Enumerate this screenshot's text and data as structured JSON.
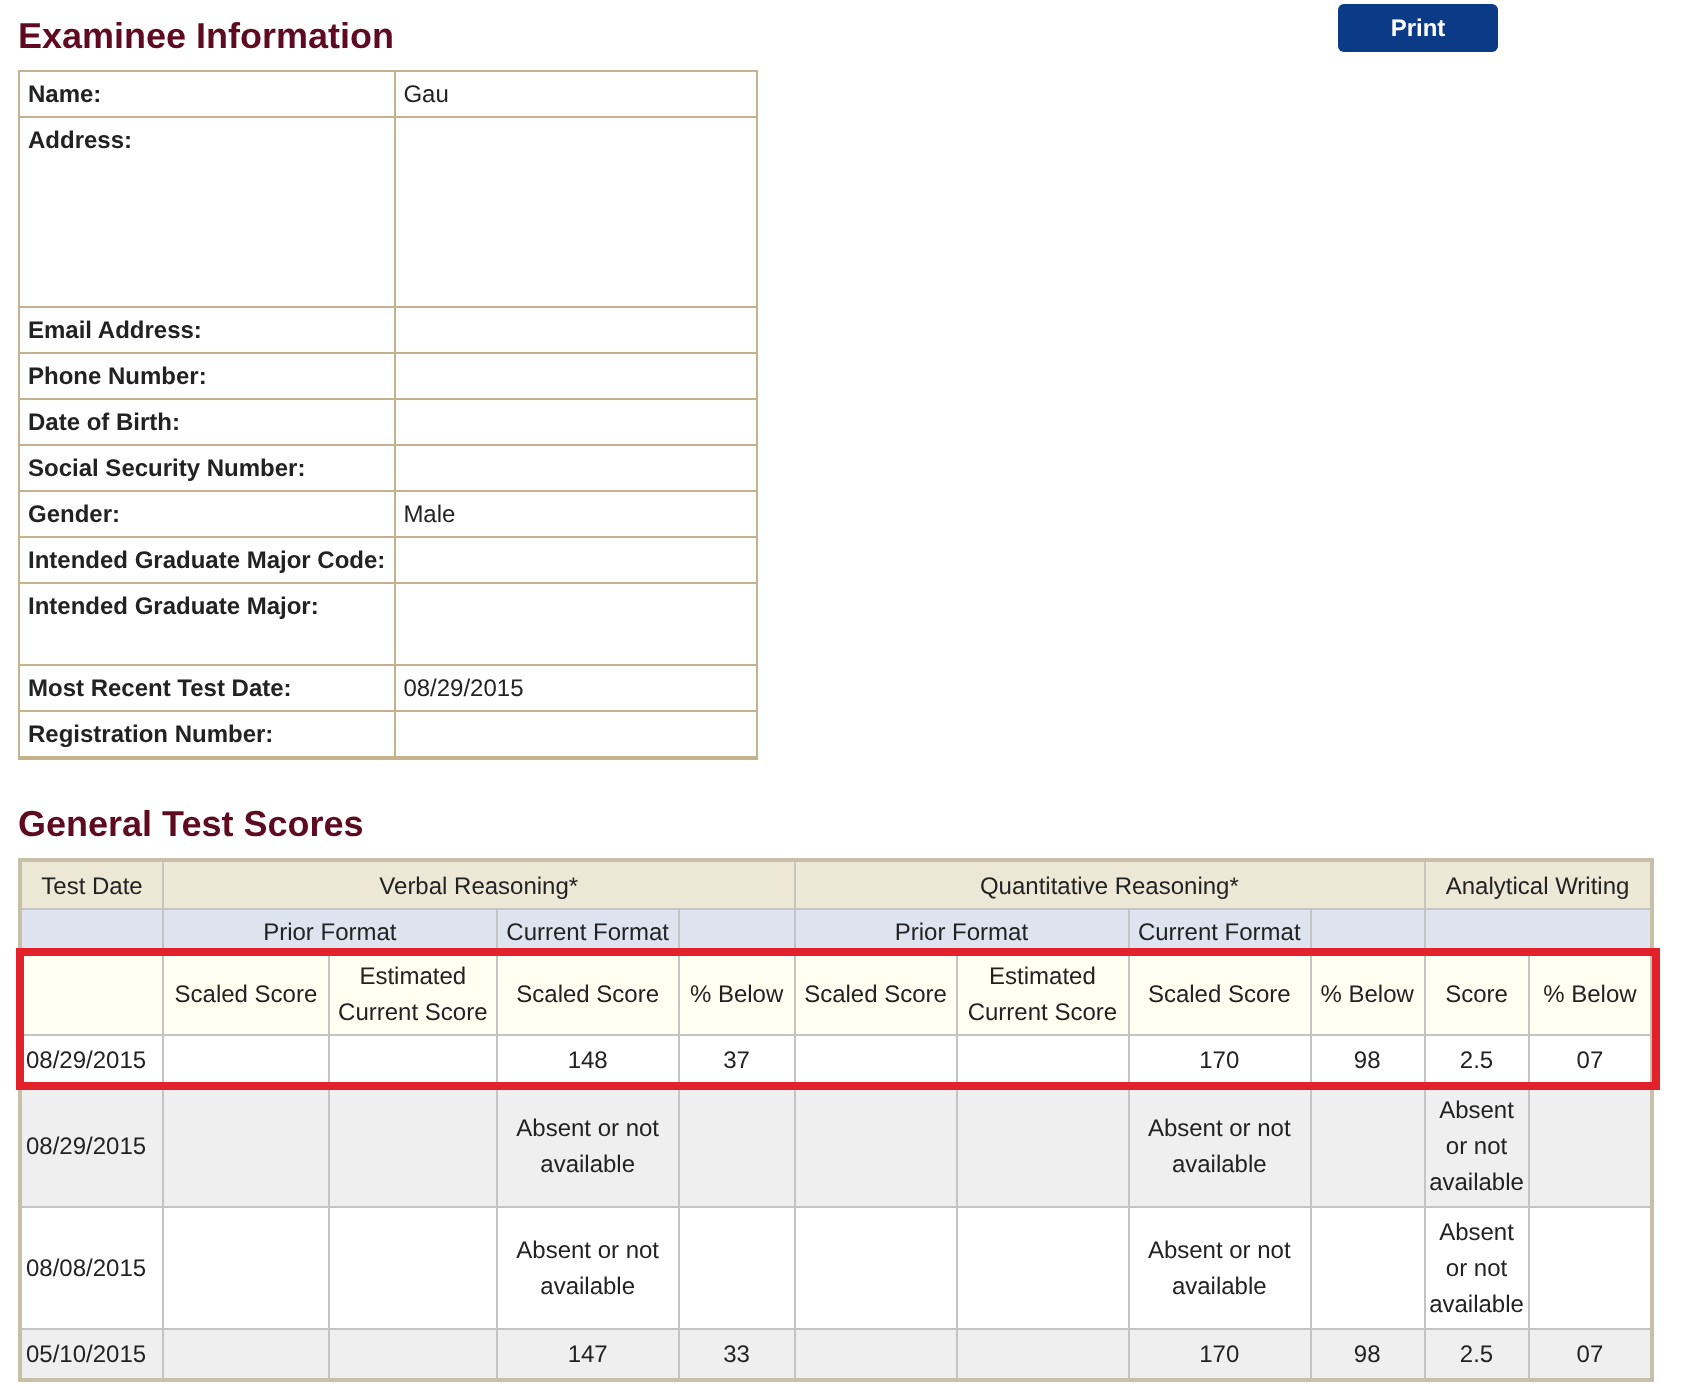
{
  "examinee_info": {
    "title": "Examinee Information",
    "rows": [
      {
        "label": "Name:",
        "value": "Gau",
        "kind": "line"
      },
      {
        "label": "Address:",
        "kind": "block"
      },
      {
        "label": "Email Address:",
        "kind": "line"
      },
      {
        "label": "Phone Number:",
        "kind": "line"
      },
      {
        "label": "Date of Birth:",
        "kind": "line"
      },
      {
        "label": "Social Security Number:",
        "kind": "line"
      },
      {
        "label": "Gender:",
        "value": "Male",
        "kind": "line"
      },
      {
        "label": "Intended Graduate Major Code:",
        "kind": "line"
      },
      {
        "label": "Intended Graduate Major:",
        "kind": "double"
      },
      {
        "label": "Most Recent Test Date:",
        "value": "08/29/2015",
        "kind": "line"
      },
      {
        "label": "Registration Number:",
        "kind": "line"
      }
    ]
  },
  "print_button": {
    "label": "Print"
  },
  "general_test_scores": {
    "title": "General Test Scores",
    "group_headers": [
      "Test Date",
      "Verbal Reasoning*",
      "Quantitative Reasoning*",
      "Analytical Writing"
    ],
    "format_headers": [
      "Prior Format",
      "Current Format",
      "Prior Format",
      "Current Format"
    ],
    "column_headers_highlighted": true,
    "column_headers": [
      "Scaled Score",
      "Estimated Current Score",
      "Scaled Score",
      "% Below",
      "Scaled Score",
      "Estimated Current Score",
      "Scaled Score",
      "% Below",
      "Score",
      "% Below"
    ],
    "rows": [
      {
        "highlighted": true,
        "cells": [
          "08/29/2015",
          null,
          null,
          "148",
          "37",
          null,
          null,
          "170",
          "98",
          "2.5",
          "07"
        ]
      },
      {
        "highlighted": false,
        "cells": [
          "08/29/2015",
          null,
          null,
          "Absent or not available",
          null,
          null,
          null,
          "Absent or not available",
          null,
          "Absent or not available",
          null
        ]
      },
      {
        "highlighted": false,
        "cells": [
          "08/08/2015",
          null,
          null,
          "Absent or not available",
          null,
          null,
          null,
          "Absent or not available",
          null,
          "Absent or not available",
          null
        ]
      },
      {
        "highlighted": false,
        "cells": [
          "05/10/2015",
          null,
          null,
          "147",
          "33",
          null,
          null,
          "170",
          "98",
          "2.5",
          "07"
        ]
      }
    ]
  }
}
